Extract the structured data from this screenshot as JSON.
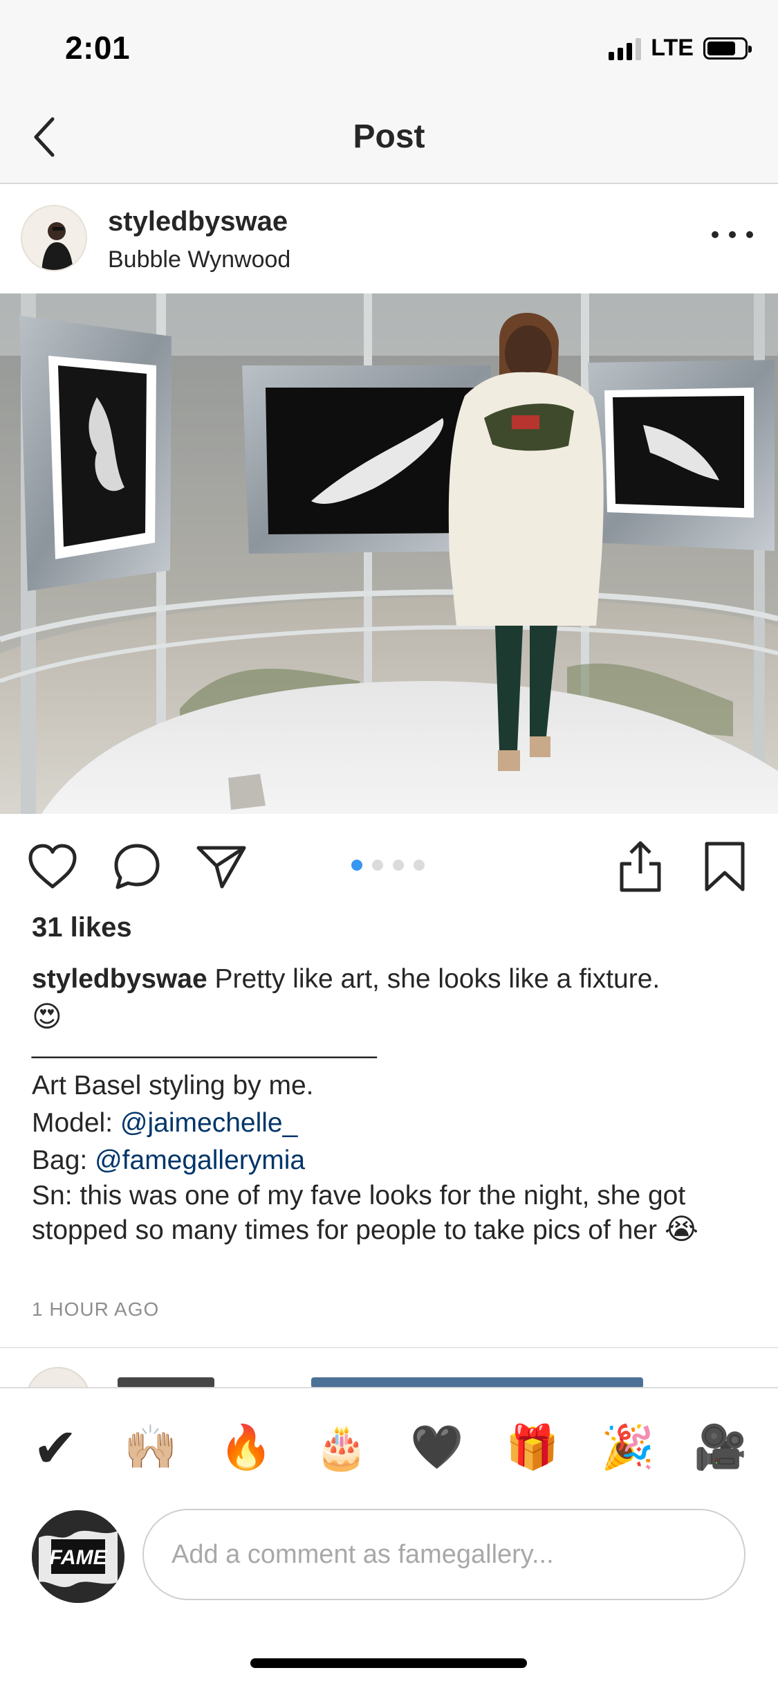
{
  "status_bar": {
    "time": "2:01",
    "network": "LTE",
    "icons": [
      "signal-icon",
      "battery-icon"
    ]
  },
  "nav": {
    "title": "Post",
    "back_icon": "chevron-left-icon"
  },
  "post": {
    "username": "styledbyswae",
    "location": "Bubble Wynwood",
    "carousel": {
      "count": 4,
      "active": 1
    },
    "likes": "31 likes",
    "caption": {
      "username": "styledbyswae",
      "text": "Pretty like art, she looks like a fixture.",
      "emoji_1": "😍",
      "separator": "_______________________",
      "line_1": "Art Basel styling by me.",
      "model_label": "Model: ",
      "model_mention": "@jaimechelle_",
      "bag_label": "Bag: ",
      "bag_mention": "@famegallerymia",
      "note": "Sn: this was one of my fave looks for the night, she got stopped so many times for people to take pics of her",
      "emoji_2": "😭"
    },
    "timestamp": "1 HOUR AGO"
  },
  "actions": [
    "heart-icon",
    "comment-icon",
    "share-icon",
    "upload-icon",
    "bookmark-icon"
  ],
  "reactions": [
    "✔",
    "🙌🏼",
    "🔥",
    "🎂",
    "🖤",
    "🎁",
    "🎉",
    "🎥"
  ],
  "comment_box": {
    "placeholder": "Add a comment as famegallery...",
    "avatar_text": "FAME"
  },
  "colors": {
    "link": "#003569",
    "dot_active": "#3897f0",
    "muted": "#8e8e8e"
  }
}
